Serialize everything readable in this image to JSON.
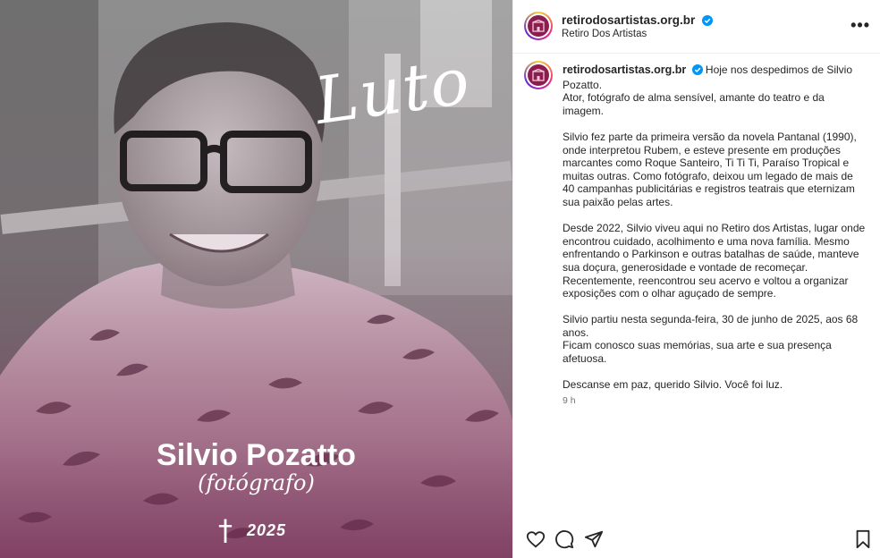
{
  "image": {
    "overlay_title": "Luto",
    "person_name": "Silvio Pozatto",
    "person_role": "(fotógrafo)",
    "cross_symbol": "†",
    "year": "2025"
  },
  "post_header": {
    "username": "retirodosartistas.org.br",
    "verified": true,
    "location": "Retiro Dos Artistas",
    "more_label": "•••"
  },
  "caption": {
    "username": "retirodosartistas.org.br",
    "lines_p1": [
      "Hoje nos despedimos de Silvio Pozatto.",
      "Ator, fotógrafo de alma sensível, amante do teatro e da imagem."
    ],
    "p2": "Silvio fez parte da primeira versão da novela Pantanal (1990), onde interpretou Rubem, e esteve presente em produções marcantes como Roque Santeiro, Ti Ti Ti, Paraíso Tropical e muitas outras. Como fotógrafo, deixou um legado de mais de 40 campanhas publicitárias e registros teatrais que eternizam sua paixão pelas artes.",
    "p3": "Desde 2022, Silvio viveu aqui no Retiro dos Artistas, lugar onde encontrou cuidado, acolhimento e uma nova família. Mesmo enfrentando o Parkinson e outras batalhas de saúde, manteve sua doçura, generosidade e vontade de recomeçar. Recentemente, reencontrou seu acervo e voltou a organizar exposições com o olhar aguçado de sempre.",
    "p4a": "Silvio partiu nesta segunda-feira, 30 de junho de 2025, aos 68 anos.",
    "p4b": "Ficam conosco suas memórias, sua arte e sua presença afetuosa.",
    "p5": "Descanse em paz, querido Silvio. Você foi luz.",
    "time": "9 h"
  },
  "actions": {
    "icons": [
      "heart-icon",
      "comment-icon",
      "share-icon",
      "bookmark-icon"
    ]
  },
  "colors": {
    "brand": "#8b1e4f",
    "verified": "#0095f6",
    "text": "#262626",
    "muted": "#737373"
  }
}
